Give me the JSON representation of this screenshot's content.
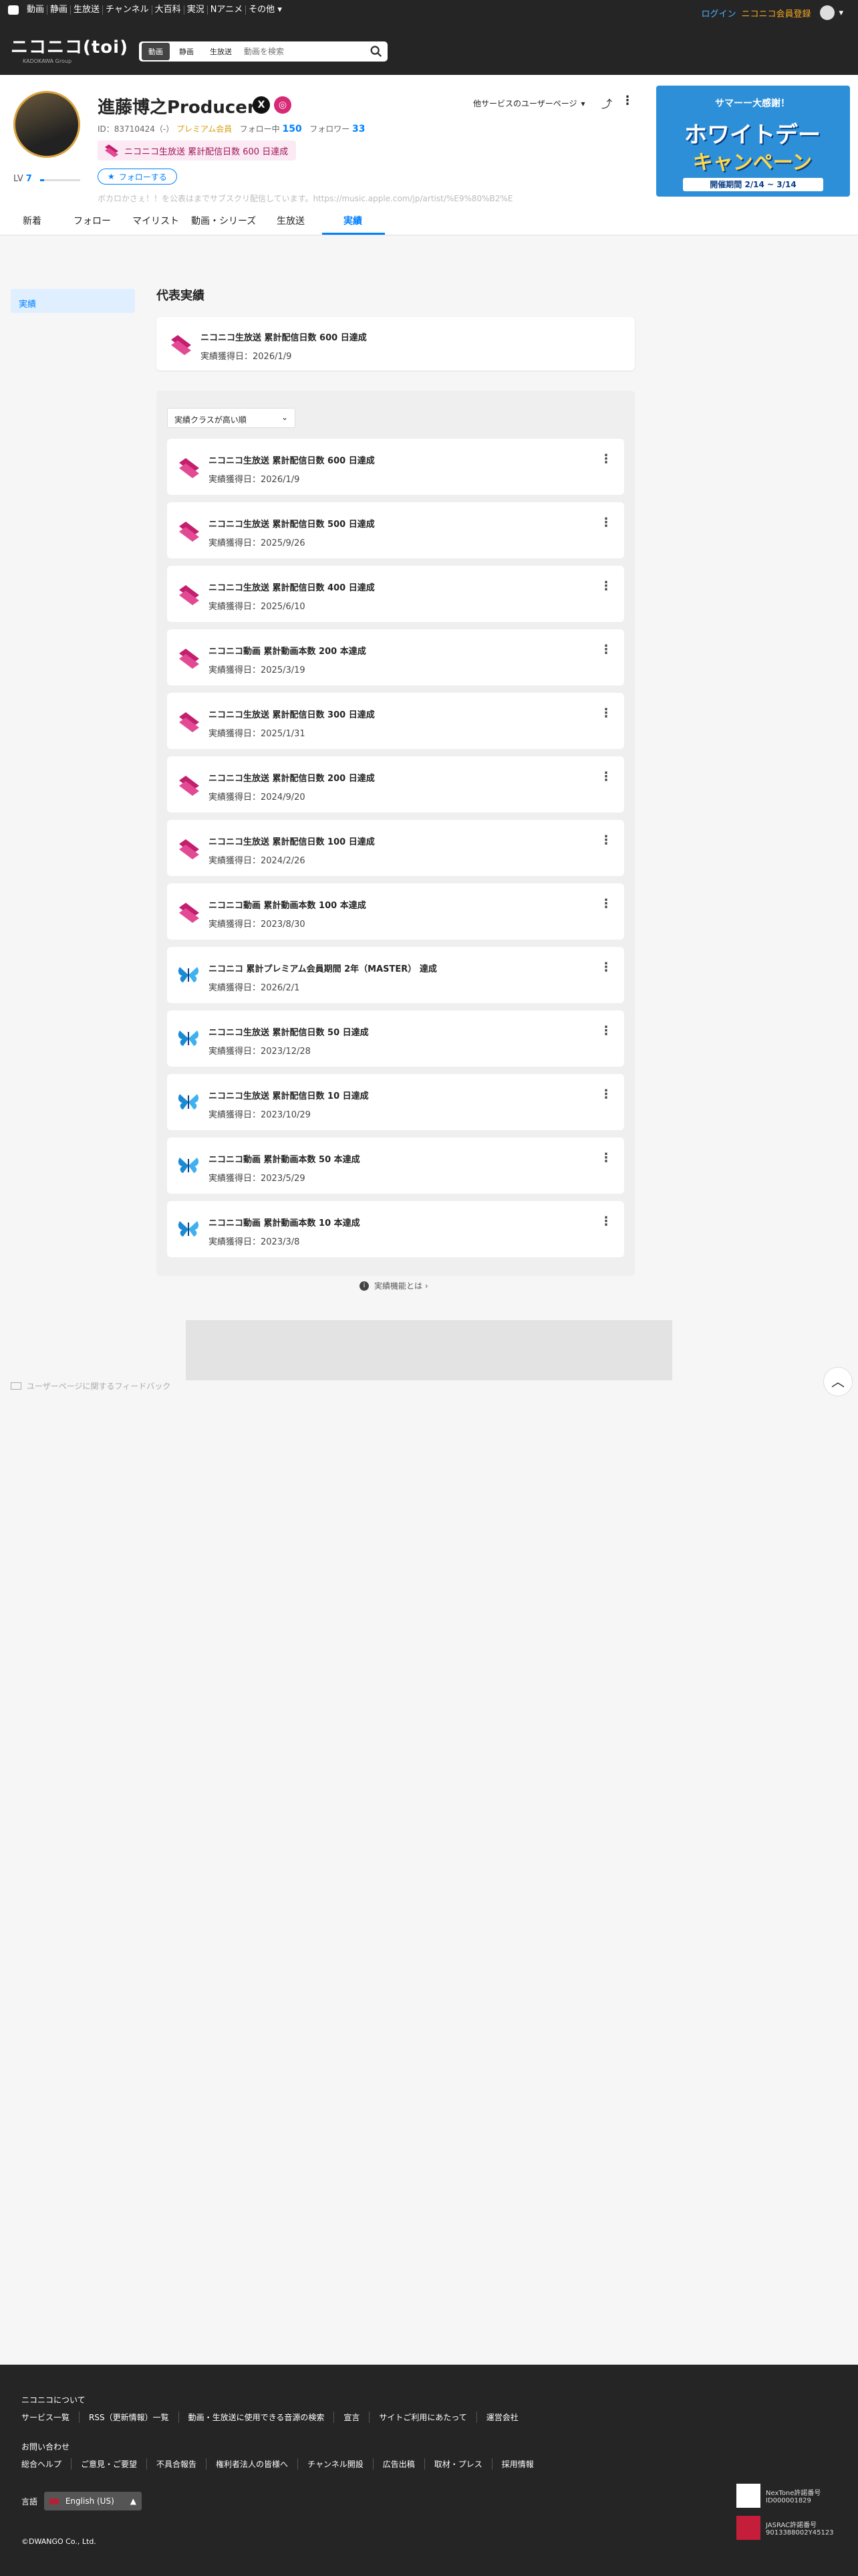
{
  "topbar": {
    "nav": [
      "動画",
      "静画",
      "生放送",
      "チャンネル",
      "大百科",
      "実況",
      "Nアニメ",
      "その他"
    ],
    "more_chevron": "▾",
    "login": "ログイン",
    "register": "ニコニコ会員登録"
  },
  "header": {
    "logo": "ニコニコ(toi)",
    "logo_sub": "KADOKAWA Group",
    "search_tabs": [
      "動画",
      "静画",
      "生放送"
    ],
    "search_placeholder": "動画を検索"
  },
  "profile": {
    "name": "進藤博之Producer",
    "level_label": "LV",
    "level": "7",
    "level_progress": 0.1,
    "id_text": "ID：83710424（-）",
    "premium": "プレミアム会員",
    "following_label": "フォロー中",
    "following": "150",
    "followers_label": "フォロワー",
    "followers": "33",
    "badge": "ニコニコ生放送 累計配信日数 600 日達成",
    "follow_button": "フォローする",
    "description": "ボカロかさぇ！！を公表はまでサブスクリ配信しています。https://music.apple.com/jp/artist/%E9%80%B2%E",
    "other_services": "他サービスのユーザーページ",
    "share_icon": "⤴",
    "more_icon": "⋮",
    "sns": [
      "X",
      "◎"
    ]
  },
  "banner": {
    "line1": "サマーー大感謝！",
    "line2": "ホワイトデー",
    "line3": "キャンペーン",
    "period": "開催期間 2/14 ~ 3/14"
  },
  "tabs": [
    "新着",
    "フォロー",
    "マイリスト",
    "動画・シリーズ",
    "生放送",
    "実績"
  ],
  "side": {
    "item": "実績"
  },
  "representative": {
    "heading": "代表実績",
    "title": "ニコニコ生放送 累計配信日数 600 日達成",
    "date": "実績獲得日：2026/1/9"
  },
  "list": {
    "sort_label": "実績クラスが高い順",
    "sort_chevron": "⌄",
    "items": [
      {
        "title": "ニコニコ生放送 累計配信日数 600 日達成",
        "date": "実績獲得日：2026/1/9",
        "icon": "pink"
      },
      {
        "title": "ニコニコ生放送 累計配信日数 500 日達成",
        "date": "実績獲得日：2025/9/26",
        "icon": "pink"
      },
      {
        "title": "ニコニコ生放送 累計配信日数 400 日達成",
        "date": "実績獲得日：2025/6/10",
        "icon": "pink"
      },
      {
        "title": "ニコニコ動画 累計動画本数 200 本達成",
        "date": "実績獲得日：2025/3/19",
        "icon": "pink"
      },
      {
        "title": "ニコニコ生放送 累計配信日数 300 日達成",
        "date": "実績獲得日：2025/1/31",
        "icon": "pink"
      },
      {
        "title": "ニコニコ生放送 累計配信日数 200 日達成",
        "date": "実績獲得日：2024/9/20",
        "icon": "pink"
      },
      {
        "title": "ニコニコ生放送 累計配信日数 100 日達成",
        "date": "実績獲得日：2024/2/26",
        "icon": "pink"
      },
      {
        "title": "ニコニコ動画 累計動画本数 100 本達成",
        "date": "実績獲得日：2023/8/30",
        "icon": "pink"
      },
      {
        "title": "ニコニコ 累計プレミアム会員期間 2年（MASTER） 達成",
        "date": "実績獲得日：2026/2/1",
        "icon": "blue"
      },
      {
        "title": "ニコニコ生放送 累計配信日数 50 日達成",
        "date": "実績獲得日：2023/12/28",
        "icon": "blue"
      },
      {
        "title": "ニコニコ生放送 累計配信日数 10 日達成",
        "date": "実績獲得日：2023/10/29",
        "icon": "blue"
      },
      {
        "title": "ニコニコ動画 累計動画本数 50 本達成",
        "date": "実績獲得日：2023/5/29",
        "icon": "blue"
      },
      {
        "title": "ニコニコ動画 累計動画本数 10 本達成",
        "date": "実績獲得日：2023/3/8",
        "icon": "blue"
      }
    ],
    "kebab": "⋮"
  },
  "about": {
    "icon": "i",
    "text": "実績機能とは ›"
  },
  "feedback": "ユーザーページに関するフィードバック",
  "totop": "︿",
  "footer": {
    "about_heading": "ニコニコについて",
    "about_links": [
      "サービス一覧",
      "RSS（更新情報）一覧",
      "動画・生放送に使用できる音源の検索",
      "宣言",
      "サイトご利用にあたって",
      "運営会社"
    ],
    "contact_heading": "お問い合わせ",
    "contact_links": [
      "総合ヘルプ",
      "ご意見・ご要望",
      "不具合報告",
      "権利者法人の皆様へ",
      "チャンネル開設",
      "広告出稿",
      "取材・プレス",
      "採用情報"
    ],
    "lang_label": "言語",
    "lang_value": "English (US)",
    "lang_arrow": "▲",
    "copyright": "©DWANGO Co., Ltd.",
    "license1_a": "NexTone許諾番号",
    "license1_b": "ID000001829",
    "license2_a": "JASRAC許諾番号",
    "license2_b": "9013388002Y45123"
  },
  "colors": {
    "accent": "#0080ff",
    "pink_icon": "#c41e6e",
    "blue_icon": "#1a8ad4",
    "header_bg": "#252525"
  }
}
